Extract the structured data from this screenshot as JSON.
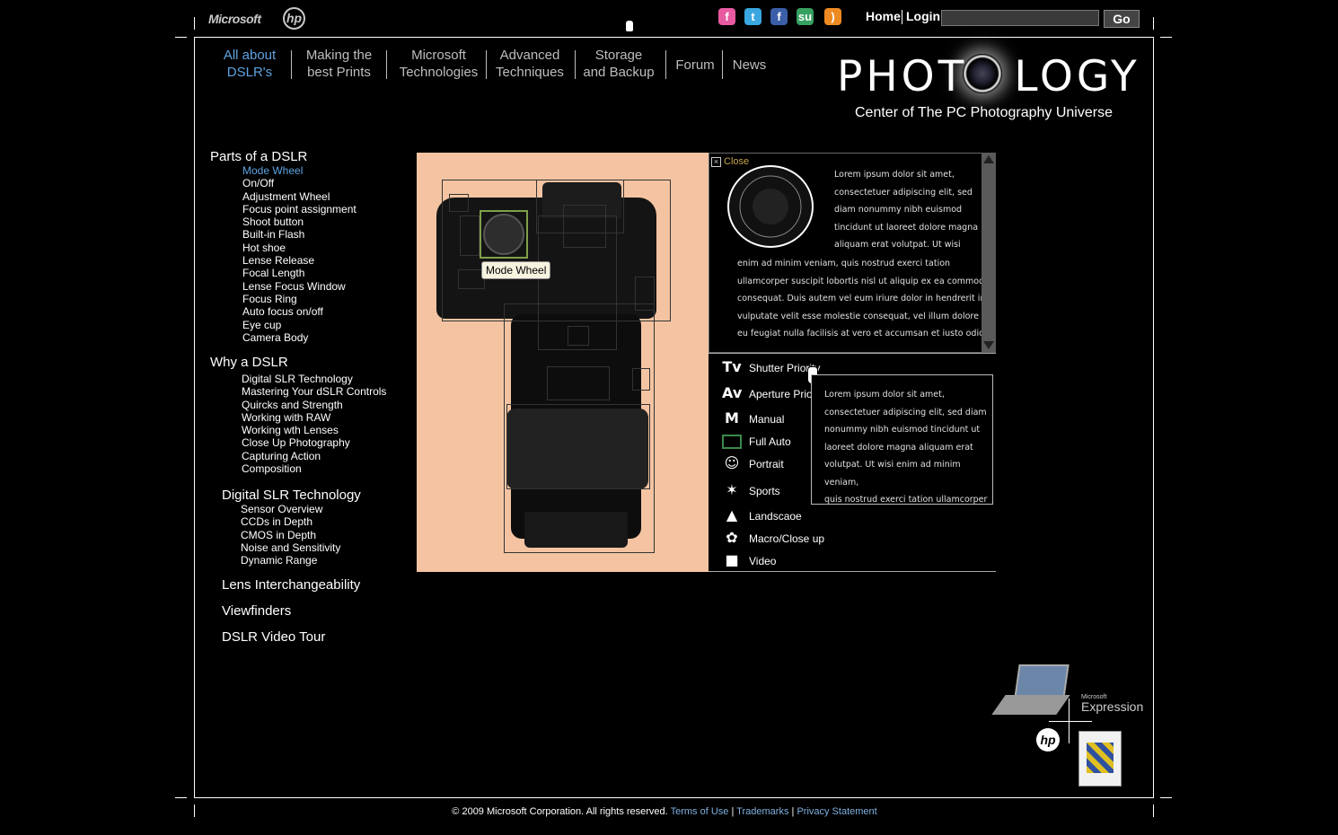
{
  "topbar": {
    "brand_ms": "Microsoft",
    "brand_hp": "hp",
    "social": [
      {
        "icon": "flickr-icon",
        "glyph": "f",
        "color": "#e85aa0"
      },
      {
        "icon": "twitter-icon",
        "glyph": "t",
        "color": "#3aa6e0"
      },
      {
        "icon": "facebook-icon",
        "glyph": "f",
        "color": "#3b5ea8"
      },
      {
        "icon": "stumbleupon-icon",
        "glyph": "su",
        "color": "#36a060"
      },
      {
        "icon": "rss-icon",
        "glyph": ")",
        "color": "#ee8a22"
      }
    ],
    "home": "Home",
    "login": "Login",
    "search_value": "",
    "go": "Go"
  },
  "nav": [
    {
      "l1": "All about",
      "l2": "DSLR's",
      "active": true
    },
    {
      "l1": "Making the",
      "l2": "best Prints"
    },
    {
      "l1": "Microsoft",
      "l2": "Technologies"
    },
    {
      "l1": "Advanced",
      "l2": "Techniques"
    },
    {
      "l1": "Storage",
      "l2": "and Backup"
    },
    {
      "l1": "Forum",
      "l2": ""
    },
    {
      "l1": "News",
      "l2": ""
    }
  ],
  "logo": {
    "pre": "PHOT",
    "post": "LOGY",
    "tagline": "Center of The PC Photography Universe"
  },
  "sidebar": {
    "parts_title": "Parts of a DSLR",
    "parts": [
      "Mode Wheel",
      "On/Off",
      "Adjustment Wheel",
      "Focus point assignment",
      "Shoot button",
      "Built-in Flash",
      "Hot shoe",
      "Lense Release",
      "Focal Length",
      "Lense Focus Window",
      "Focus Ring",
      "Auto focus on/off",
      "Eye cup",
      "Camera Body"
    ],
    "why_title": "Why a DSLR",
    "why": [
      "Digital SLR Technology",
      "Mastering Your dSLR Controls",
      "Quircks and Strength",
      "Working with RAW",
      "Working wth Lenses",
      "Close Up Photography",
      "Capturing Action",
      "Composition"
    ],
    "tech_title": "Digital SLR Technology",
    "tech": [
      "Sensor Overview",
      "CCDs in Depth",
      "CMOS in Depth",
      "Noise and Sensitivity",
      "Dynamic Range"
    ],
    "lens": "Lens Interchangeability",
    "viewfinders": "Viewfinders",
    "video": "DSLR Video Tour"
  },
  "camera": {
    "tooltip": "Mode Wheel"
  },
  "info": {
    "close": "Close",
    "lines": [
      "Lorem ipsum dolor sit amet,",
      "consectetuer adipiscing elit, sed",
      "diam nonummy nibh euismod",
      "tincidunt ut laoreet dolore magna",
      "aliquam erat volutpat. Ut wisi",
      "enim ad minim veniam, quis nostrud exerci tation",
      "ullamcorper suscipit lobortis nisl ut aliquip ex ea commodo",
      "consequat. Duis autem vel eum iriure dolor in hendrerit in",
      "vulputate velit esse molestie consequat, vel illum dolore",
      "eu feugiat nulla facilisis at vero et accumsan et iusto odio"
    ]
  },
  "modes": [
    {
      "icon": "Tv",
      "label": "Shutter Priority",
      "name": "tv-icon"
    },
    {
      "icon": "Av",
      "label": "Aperture Prio",
      "name": "av-icon"
    },
    {
      "icon": "M",
      "label": "Manual",
      "name": "manual-icon"
    },
    {
      "icon": "",
      "label": "Full Auto",
      "name": "full-auto-icon"
    },
    {
      "icon": "☺",
      "label": "Portrait",
      "name": "portrait-icon"
    },
    {
      "icon": "✶",
      "label": "Sports",
      "name": "sports-icon"
    },
    {
      "icon": "▲",
      "label": "Landscaoe",
      "name": "landscape-icon"
    },
    {
      "icon": "✿",
      "label": "Macro/Close up",
      "name": "macro-icon"
    },
    {
      "icon": "■",
      "label": "Video",
      "name": "video-icon"
    }
  ],
  "popup": {
    "lines": [
      "Lorem ipsum dolor sit amet,",
      "consectetuer adipiscing elit, sed diam",
      "nonummy nibh euismod tincidunt ut",
      "laoreet dolore magna aliquam erat",
      "volutpat. Ut wisi enim ad minim veniam,",
      "quis nostrud exerci tation ullamcorper"
    ]
  },
  "promo": {
    "expression_small": "Microsoft",
    "expression": "Expression",
    "hp": "hp"
  },
  "footer": {
    "copyright": "© 2009 Microsoft Corporation. All rights reserved.",
    "terms": "Terms of Use",
    "trademarks": "Trademarks",
    "privacy": "Privacy Statement"
  }
}
